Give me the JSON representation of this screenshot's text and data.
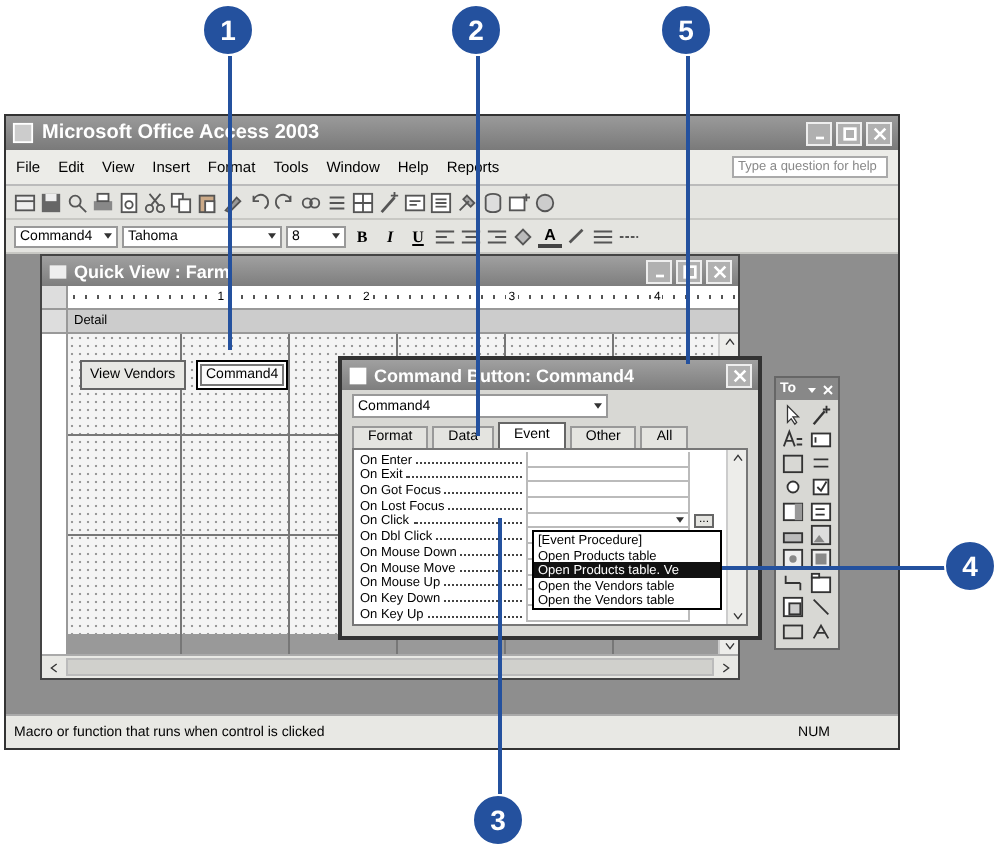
{
  "window": {
    "title": "Microsoft Office Access 2003"
  },
  "menu": [
    "File",
    "Edit",
    "View",
    "Insert",
    "Format",
    "Tools",
    "Window",
    "Help",
    "Reports"
  ],
  "help_box": {
    "placeholder": "Type a question for help"
  },
  "formatting_toolbar": {
    "object": "Command4",
    "font": "Tahoma",
    "size": "8",
    "style_buttons": [
      "B",
      "I",
      "U"
    ],
    "font_color": "A"
  },
  "form_window": {
    "title": "Quick View : Farm",
    "section": "Detail",
    "ruler_labels": [
      "1",
      "2",
      "3",
      "4"
    ],
    "controls": [
      {
        "label": "View Vendors",
        "selected": false
      },
      {
        "label": "Command4",
        "selected": true
      }
    ]
  },
  "property_sheet": {
    "title": "Command Button: Command4",
    "object": "Command4",
    "tabs": [
      {
        "label": "Format",
        "selected": false
      },
      {
        "label": "Data",
        "selected": false
      },
      {
        "label": "Event",
        "selected": true
      },
      {
        "label": "Other",
        "selected": false
      },
      {
        "label": "All",
        "selected": false
      }
    ],
    "properties": [
      {
        "name": "On Enter",
        "kind": "text"
      },
      {
        "name": "On Exit",
        "kind": "text"
      },
      {
        "name": "On Got Focus",
        "kind": "text"
      },
      {
        "name": "On Lost Focus",
        "kind": "text"
      },
      {
        "name": "On Click",
        "kind": "dropdown",
        "builder": "..."
      },
      {
        "name": "On Dbl Click",
        "kind": "text"
      },
      {
        "name": "On Mouse Down",
        "kind": "text"
      },
      {
        "name": "On Mouse Move",
        "kind": "text"
      },
      {
        "name": "On Mouse Up",
        "kind": "text"
      },
      {
        "name": "On Key Down",
        "kind": "text"
      },
      {
        "name": "On Key Up",
        "kind": "text"
      }
    ],
    "dropdown_options": [
      {
        "label": "[Event Procedure]",
        "selected": false
      },
      {
        "label": "Open Products table",
        "selected": false
      },
      {
        "label": "Open Products table. Ve",
        "selected": true
      },
      {
        "label": "Open the Vendors table",
        "selected": false
      },
      {
        "label": "Open the Vendors table",
        "selected": false
      }
    ]
  },
  "toolbox": {
    "title": "To"
  },
  "status_bar": {
    "message": "Macro or function that runs when control is clicked",
    "indicator": "NUM"
  },
  "callouts": [
    {
      "number": "1"
    },
    {
      "number": "2"
    },
    {
      "number": "5"
    },
    {
      "number": "3"
    },
    {
      "number": "4"
    }
  ]
}
